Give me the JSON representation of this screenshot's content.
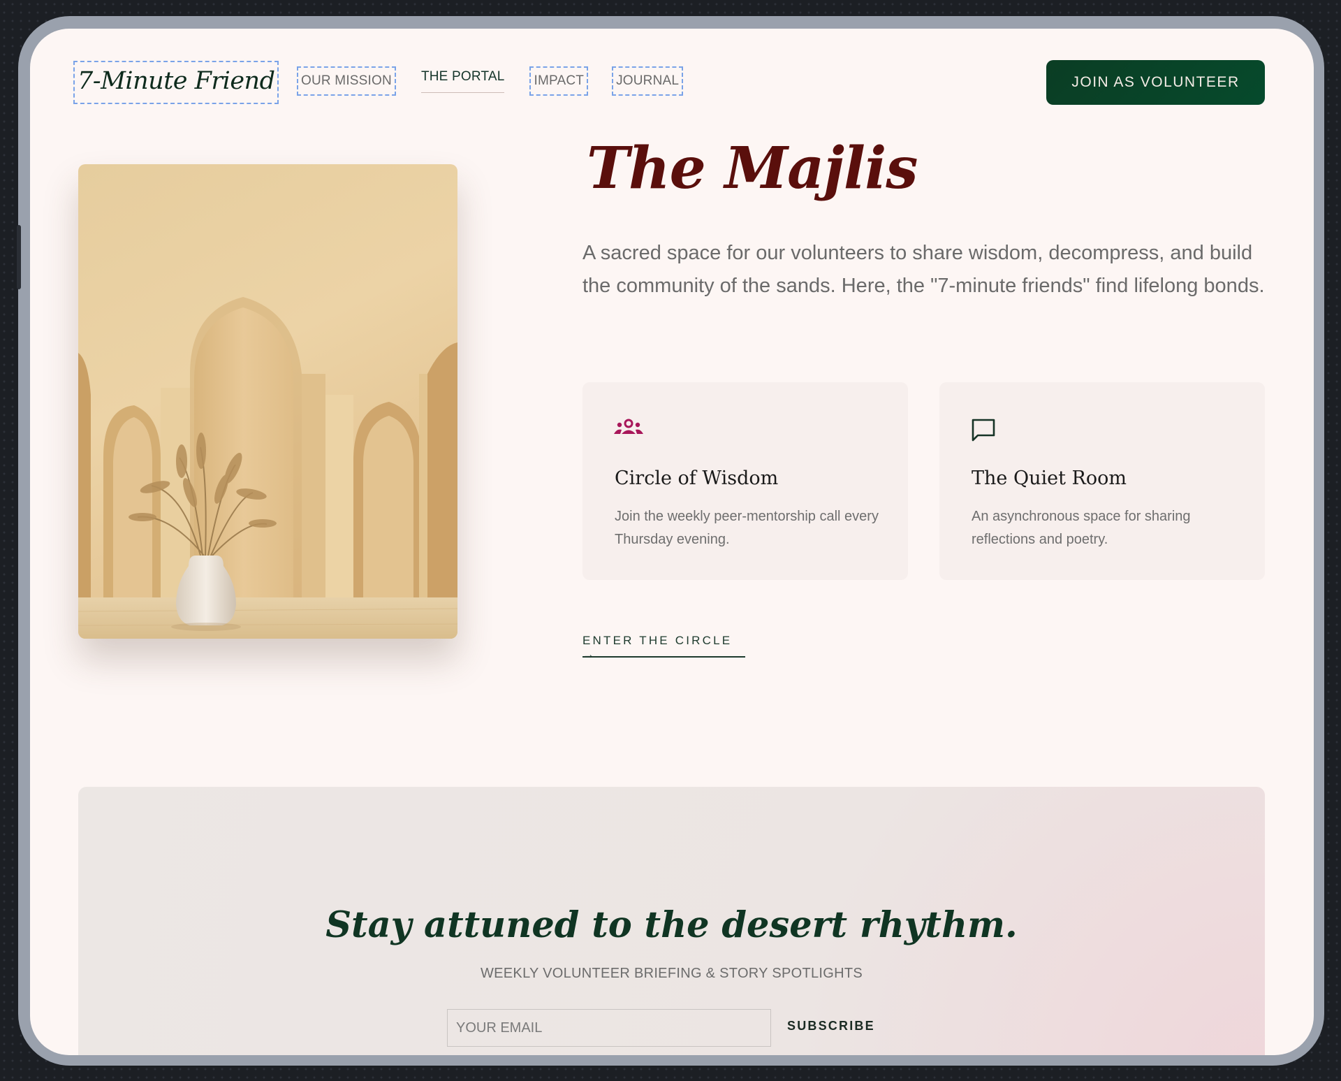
{
  "header": {
    "logo": "7-Minute Friend",
    "nav": [
      {
        "label": "OUR MISSION"
      },
      {
        "label": "THE PORTAL"
      },
      {
        "label": "IMPACT"
      },
      {
        "label": "JOURNAL"
      }
    ],
    "cta": "JOIN AS VOLUNTEER"
  },
  "hero": {
    "title": "The Majlis",
    "description": "A sacred space for our volunteers to share wisdom, decompress, and build the community of the sands. Here, the \"7-minute friends\" find lifelong bonds.",
    "cards": [
      {
        "icon": "group-icon",
        "title": "Circle of Wisdom",
        "text": "Join the weekly peer-mentorship call every Thursday evening."
      },
      {
        "icon": "chat-bubble-icon",
        "title": "The Quiet Room",
        "text": "An asynchronous space for sharing reflections and poetry."
      }
    ],
    "link": "ENTER THE CIRCLE →"
  },
  "newsletter": {
    "title": "Stay attuned to the desert rhythm.",
    "subtitle": "WEEKLY VOLUNTEER BRIEFING & STORY SPOTLIGHTS",
    "email_placeholder": "YOUR EMAIL",
    "button": "SUBSCRIBE"
  },
  "colors": {
    "accent_green": "#064a2c",
    "title_maroon": "#5a0f0c",
    "icon_magenta": "#a8175a",
    "page_bg": "#fdf6f4"
  }
}
